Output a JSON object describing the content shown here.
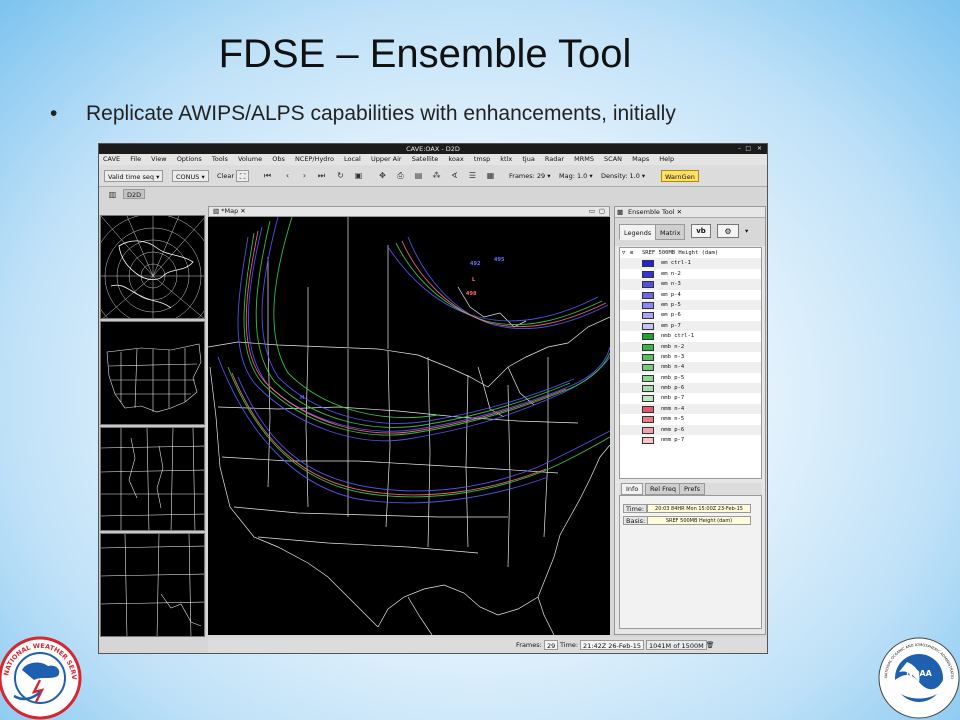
{
  "slide": {
    "title": "FDSE – Ensemble Tool",
    "bullet_glyph": "•",
    "bullet": "Replicate AWIPS/ALPS capabilities with enhancements, initially"
  },
  "window": {
    "title": "CAVE:OAX - D2D",
    "controls": [
      "–",
      "□",
      "✕"
    ]
  },
  "menu": [
    "CAVE",
    "File",
    "View",
    "Options",
    "Tools",
    "Volume",
    "Obs",
    "NCEP/Hydro",
    "Local",
    "Upper Air",
    "Satellite",
    "koax",
    "tmsp",
    "ktlx",
    "tjua",
    "Radar",
    "MRMS",
    "SCAN",
    "Maps",
    "Help"
  ],
  "toolbar": {
    "valid_time": "Valid time seq",
    "area": "CONUS",
    "clear": "Clear",
    "frames": "Frames: 29",
    "mag": "Mag: 1.0",
    "density": "Density: 1.0",
    "warngen": "WarnGen",
    "dropdown_glyph": "▾"
  },
  "perspective": {
    "d2d": "D2D"
  },
  "map": {
    "tab_label": "*Map",
    "status": {
      "frames_label": "Frames:",
      "frames_value": "29",
      "time_label": "Time:",
      "time_value": "21:42Z 26-Feb-15",
      "memory": "1041M of 1500M"
    },
    "labels": [
      {
        "text": "492",
        "color": "#6d6dff"
      },
      {
        "text": "498",
        "color": "#ff6a6a"
      },
      {
        "text": "495",
        "color": "#6d6dff"
      },
      {
        "text": "H",
        "color": "#6d6dff"
      },
      {
        "text": "L",
        "color": "#ff6a6a"
      }
    ]
  },
  "ensemble": {
    "view_title": "Ensemble Tool",
    "tabs": {
      "legends": "Legends",
      "matrix": "Matrix"
    },
    "vb": "vb",
    "group_name": "SREF 500MB Height (dam)",
    "members": [
      {
        "name": "em ctrl-1",
        "color": "#2424d4"
      },
      {
        "name": "em n-2",
        "color": "#3434dc"
      },
      {
        "name": "em n-3",
        "color": "#5050e0"
      },
      {
        "name": "em p-4",
        "color": "#6a6ae6"
      },
      {
        "name": "em p-5",
        "color": "#8a8aee"
      },
      {
        "name": "em p-6",
        "color": "#a6a6f2"
      },
      {
        "name": "em p-7",
        "color": "#c4c4f6"
      },
      {
        "name": "nmb ctrl-1",
        "color": "#1fa32a"
      },
      {
        "name": "nmb n-2",
        "color": "#3cb346"
      },
      {
        "name": "nmb n-3",
        "color": "#58bf60"
      },
      {
        "name": "nmb n-4",
        "color": "#74c97a"
      },
      {
        "name": "nmb p-5",
        "color": "#8fd493"
      },
      {
        "name": "nmb p-6",
        "color": "#a6dcaa"
      },
      {
        "name": "nmb p-7",
        "color": "#bfe6c2"
      },
      {
        "name": "nmm n-4",
        "color": "#e05b6a"
      },
      {
        "name": "nmm n-5",
        "color": "#e87c88"
      },
      {
        "name": "nmm p-6",
        "color": "#f0a3ab"
      },
      {
        "name": "nmm p-7",
        "color": "#f6c6cb"
      }
    ],
    "info_tabs": {
      "info": "Info",
      "rel_freq": "Rel Freq",
      "prefs": "Prefs"
    },
    "info": {
      "time_label": "Time:",
      "time_value": "20:03  84HR Mon 15:00Z 23-Feb-15",
      "basis_label": "Basis:",
      "basis_value": "SREF 500MB Height (dam)"
    }
  },
  "logos": {
    "nws_text": "NATIONAL WEATHER SERVICE",
    "noaa_text": "NOAA",
    "noaa_ring_text": "NATIONAL OCEANIC AND ATMOSPHERIC ADMINISTRATION · U.S. DEPARTMENT OF COMMERCE"
  },
  "colors": {
    "em_lines": "#5a5aff",
    "nmb_lines": "#3fd34a",
    "nmm_lines": "#ff6f7f",
    "map_outline": "#e8e8e8",
    "noaa_blue": "#1f5fb0",
    "nws_red": "#d7262e"
  }
}
